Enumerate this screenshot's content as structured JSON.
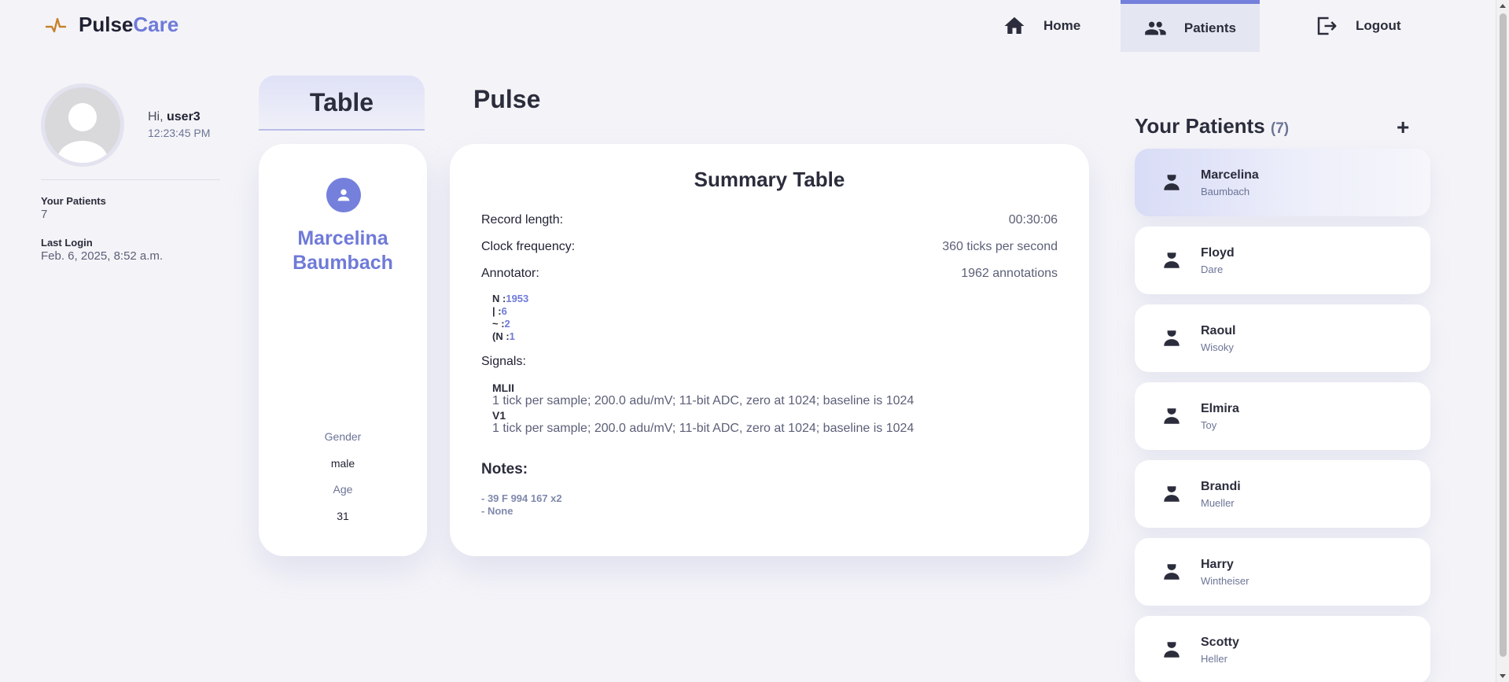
{
  "app": {
    "name_part1": "Pulse",
    "name_part2": "Care"
  },
  "nav": {
    "home": "Home",
    "patients": "Patients",
    "logout": "Logout"
  },
  "user": {
    "greeting": "Hi, ",
    "username": "user3",
    "time": "12:23:45 PM",
    "patients_label": "Your Patients",
    "patients_count": "7",
    "last_login_label": "Last Login",
    "last_login": "Feb. 6, 2025, 8:52 a.m."
  },
  "tabs": {
    "table": "Table",
    "pulse": "Pulse"
  },
  "patient": {
    "first_name": "Marcelina",
    "last_name": "Baumbach",
    "gender_label": "Gender",
    "gender": "male",
    "age_label": "Age",
    "age": "31"
  },
  "summary": {
    "title": "Summary Table",
    "rows": [
      {
        "key": "Record length:",
        "value": "00:30:06"
      },
      {
        "key": "Clock frequency:",
        "value": "360 ticks per second"
      },
      {
        "key": "Annotator:",
        "value": "1962 annotations"
      }
    ],
    "annotations": [
      {
        "sym": "N :",
        "count": "1953"
      },
      {
        "sym": "| :",
        "count": "6"
      },
      {
        "sym": "~ :",
        "count": "2"
      },
      {
        "sym": "(N :",
        "count": "1"
      }
    ],
    "signals_label": "Signals:",
    "signals": [
      {
        "name": "MLII",
        "desc": "1 tick per sample; 200.0 adu/mV; 11-bit ADC, zero at 1024; baseline is 1024"
      },
      {
        "name": "V1",
        "desc": "1 tick per sample; 200.0 adu/mV; 11-bit ADC, zero at 1024; baseline is 1024"
      }
    ],
    "notes_label": "Notes:",
    "notes": [
      "- 39 F 994 167 x2",
      "- None"
    ]
  },
  "patients_panel": {
    "title": "Your Patients",
    "count": "(7)",
    "add": "+",
    "items": [
      {
        "first": "Marcelina",
        "last": "Baumbach"
      },
      {
        "first": "Floyd",
        "last": "Dare"
      },
      {
        "first": "Raoul",
        "last": "Wisoky"
      },
      {
        "first": "Elmira",
        "last": "Toy"
      },
      {
        "first": "Brandi",
        "last": "Mueller"
      },
      {
        "first": "Harry",
        "last": "Wintheiser"
      },
      {
        "first": "Scotty",
        "last": "Heller"
      }
    ]
  },
  "colors": {
    "accent": "#7480db",
    "logo_orange": "#c8812a"
  },
  "icons": [
    "pulse-logo-icon",
    "home-icon",
    "patients-icon",
    "logout-icon",
    "avatar-icon",
    "person-icon",
    "add-icon"
  ]
}
